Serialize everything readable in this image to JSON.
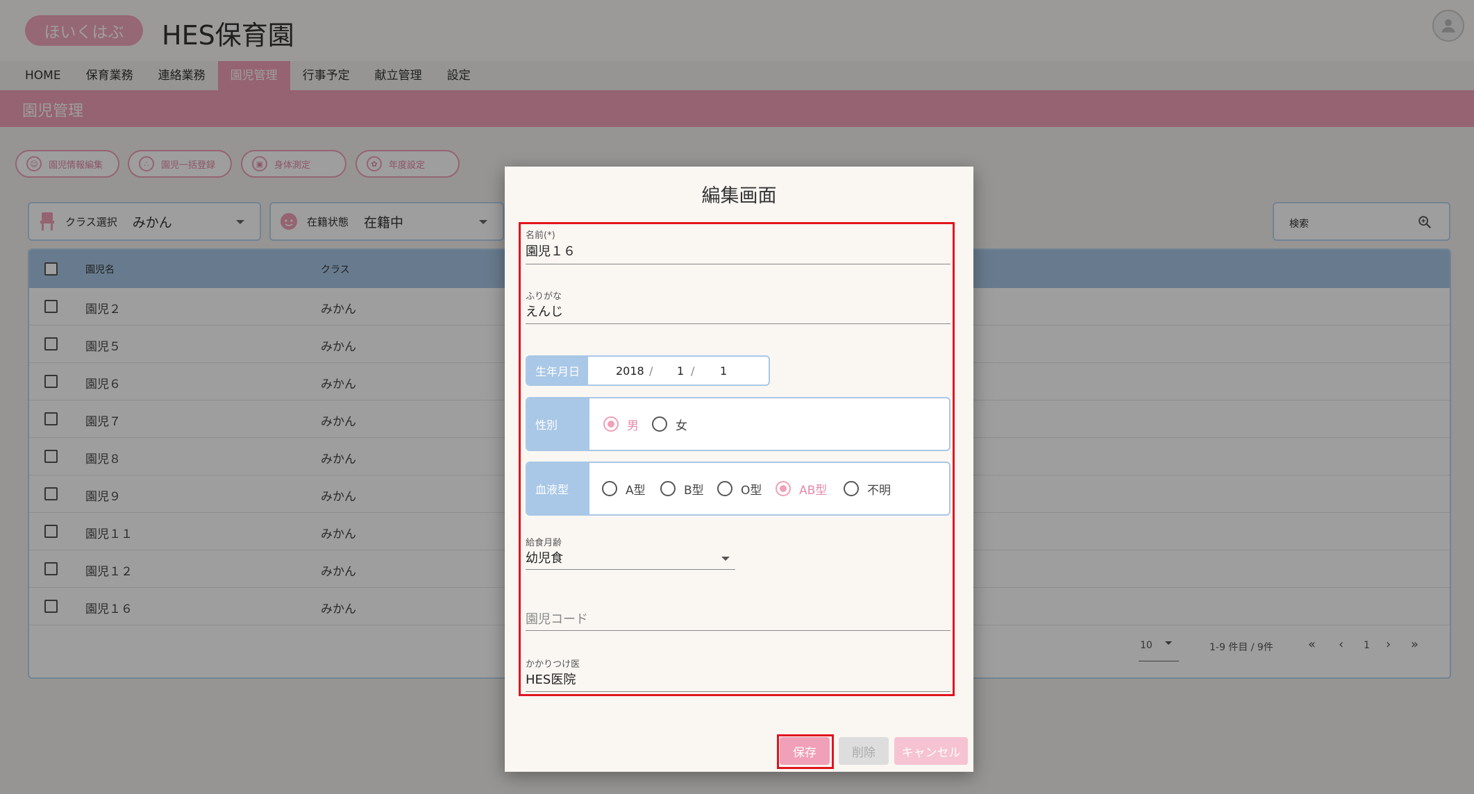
{
  "header": {
    "logo_text": "ほいくはぶ",
    "site_title": "HES保育園"
  },
  "nav": [
    {
      "label": "HOME"
    },
    {
      "label": "保育業務"
    },
    {
      "label": "連絡業務"
    },
    {
      "label": "園児管理"
    },
    {
      "label": "行事予定"
    },
    {
      "label": "献立管理"
    },
    {
      "label": "設定"
    }
  ],
  "nav_active": "園児管理",
  "page": {
    "title": "園児管理"
  },
  "toolbar": {
    "buttons": [
      {
        "label": "園児情報編集"
      },
      {
        "label": "園児一括登録"
      },
      {
        "label": "身体測定"
      },
      {
        "label": "年度設定"
      }
    ]
  },
  "filters": {
    "class": {
      "label": "クラス選択",
      "value": "みかん"
    },
    "status": {
      "label": "在籍状態",
      "value": "在籍中"
    }
  },
  "search": {
    "label": "検索"
  },
  "table": {
    "columns": [
      "園児名",
      "クラス"
    ],
    "rows": [
      {
        "name": "園児２",
        "class": "みかん"
      },
      {
        "name": "園児５",
        "class": "みかん"
      },
      {
        "name": "園児６",
        "class": "みかん"
      },
      {
        "name": "園児７",
        "class": "みかん"
      },
      {
        "name": "園児８",
        "class": "みかん"
      },
      {
        "name": "園児９",
        "class": "みかん"
      },
      {
        "name": "園児１１",
        "class": "みかん"
      },
      {
        "name": "園児１２",
        "class": "みかん"
      },
      {
        "name": "園児１６",
        "class": "みかん"
      }
    ]
  },
  "pagination": {
    "per_page": "10",
    "range": "1-9 件目 / 9件",
    "current_page": "1",
    "first": "«",
    "prev": "‹",
    "next": "›",
    "last": "»"
  },
  "modal": {
    "title": "編集画面",
    "name": {
      "label": "名前(*)",
      "value": "園児１６"
    },
    "furigana": {
      "label": "ふりがな",
      "value": "えんじ"
    },
    "dob": {
      "label": "生年月日",
      "year": "2018",
      "month": "1",
      "day": "1"
    },
    "gender": {
      "label": "性別",
      "options": [
        "男",
        "女"
      ],
      "selected": "男"
    },
    "blood": {
      "label": "血液型",
      "options": [
        "A型",
        "B型",
        "O型",
        "AB型",
        "不明"
      ],
      "selected": "AB型"
    },
    "meal": {
      "label": "給食月齢",
      "value": "幼児食"
    },
    "code": {
      "placeholder": "園児コード"
    },
    "doctor": {
      "label": "かかりつけ医",
      "value": "HES医院"
    },
    "buttons": {
      "save": "保存",
      "delete": "削除",
      "cancel": "キャンセル"
    }
  },
  "colors": {
    "accent_pink": "#f0a0b8",
    "accent_blue": "#a9c7e6",
    "highlight_red": "#e0141e"
  }
}
